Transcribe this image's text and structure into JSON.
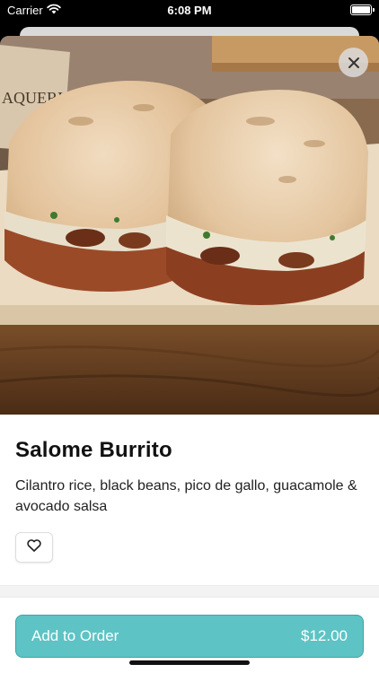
{
  "status_bar": {
    "carrier": "Carrier",
    "time": "6:08 PM",
    "wifi_icon": "wifi-icon",
    "battery_icon": "battery-icon",
    "battery_level": 1.0
  },
  "hero_image": {
    "alt": "Salome Burrito photo",
    "sign_text": "AQUERIA"
  },
  "item": {
    "name": "Salome Burrito",
    "description": "Cilantro rice, black beans, pico de gallo, guacamole & avocado salsa"
  },
  "actions": {
    "close_icon": "close-icon",
    "favorite_icon": "heart-icon"
  },
  "order": {
    "add_label": "Add to Order",
    "price": "$12.00"
  },
  "colors": {
    "accent": "#5ec3c4",
    "accent_border": "#3aa5a6"
  }
}
